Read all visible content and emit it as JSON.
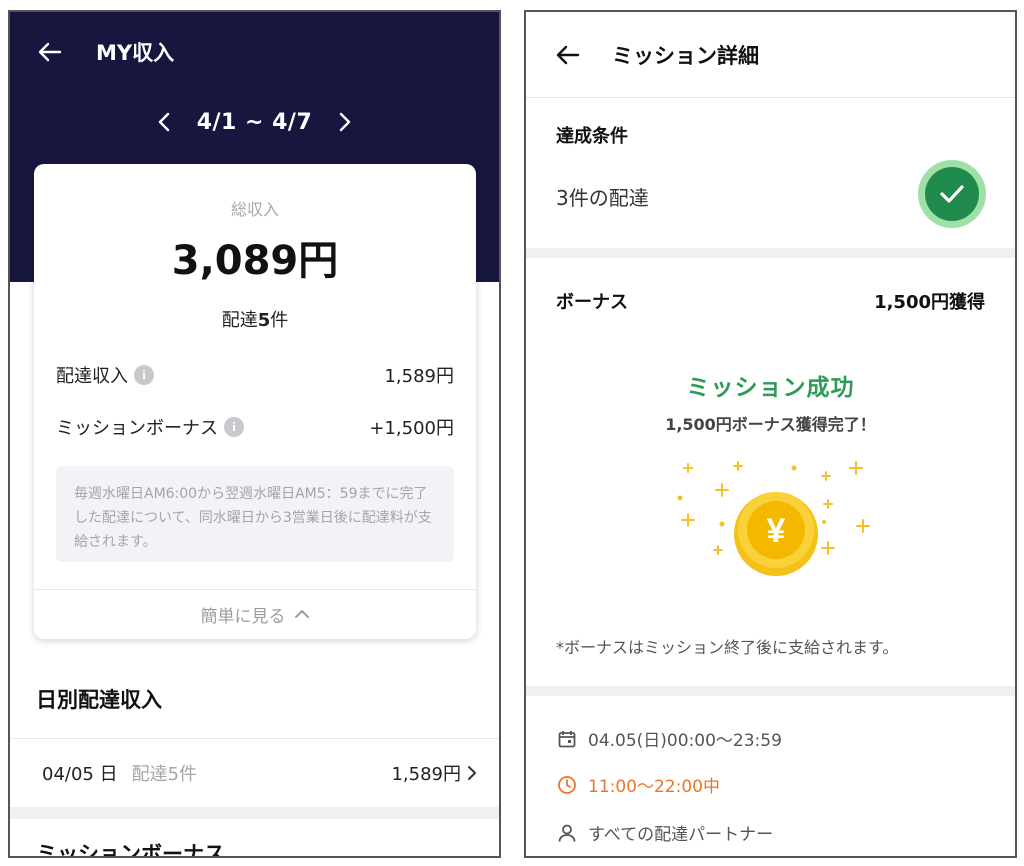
{
  "left_screen": {
    "header": {
      "title": "MY収入"
    },
    "week_nav": {
      "range": "4/1 ~ 4/7"
    },
    "summary": {
      "total_label": "総収入",
      "total_value": "3,089円",
      "delivery_prefix": "配達",
      "delivery_count": "5",
      "delivery_suffix": "件",
      "rows": [
        {
          "label": "配達収入",
          "value": "1,589円"
        },
        {
          "label": "ミッションボーナス",
          "value": "+1,500円"
        }
      ],
      "note": "毎週水曜日AM6:00から翌週水曜日AM5：59までに完了した配達について、同水曜日から3営業日後に配達料が支給されます。",
      "collapse_label": "簡単に見る"
    },
    "daily": {
      "title": "日別配達収入",
      "rows": [
        {
          "date": "04/05 日",
          "count": "配達5件",
          "amount": "1,589円"
        }
      ]
    },
    "mission_section_title": "ミッションボーナス"
  },
  "right_screen": {
    "header": {
      "title": "ミッション詳細"
    },
    "condition": {
      "label": "達成条件",
      "text": "3件の配達",
      "status": "completed"
    },
    "bonus": {
      "label": "ボーナス",
      "value": "1,500円獲得",
      "success_title": "ミッション成功",
      "success_sub": "1,500円ボーナス獲得完了！",
      "coin_symbol": "¥"
    },
    "footnote": "*ボーナスはミッション終了後に支給されます。",
    "details": [
      {
        "icon": "calendar-icon",
        "text": "04.05(日)00:00〜23:59"
      },
      {
        "icon": "clock-icon",
        "text": "11:00〜22:00中"
      },
      {
        "icon": "person-icon",
        "text": "すべての配達パートナー"
      }
    ]
  },
  "colors": {
    "navy": "#17163f",
    "success_green": "#2e9a55",
    "check_green": "#1f8a4c",
    "coin_gold": "#f5b800",
    "accent_orange": "#e8762a"
  }
}
